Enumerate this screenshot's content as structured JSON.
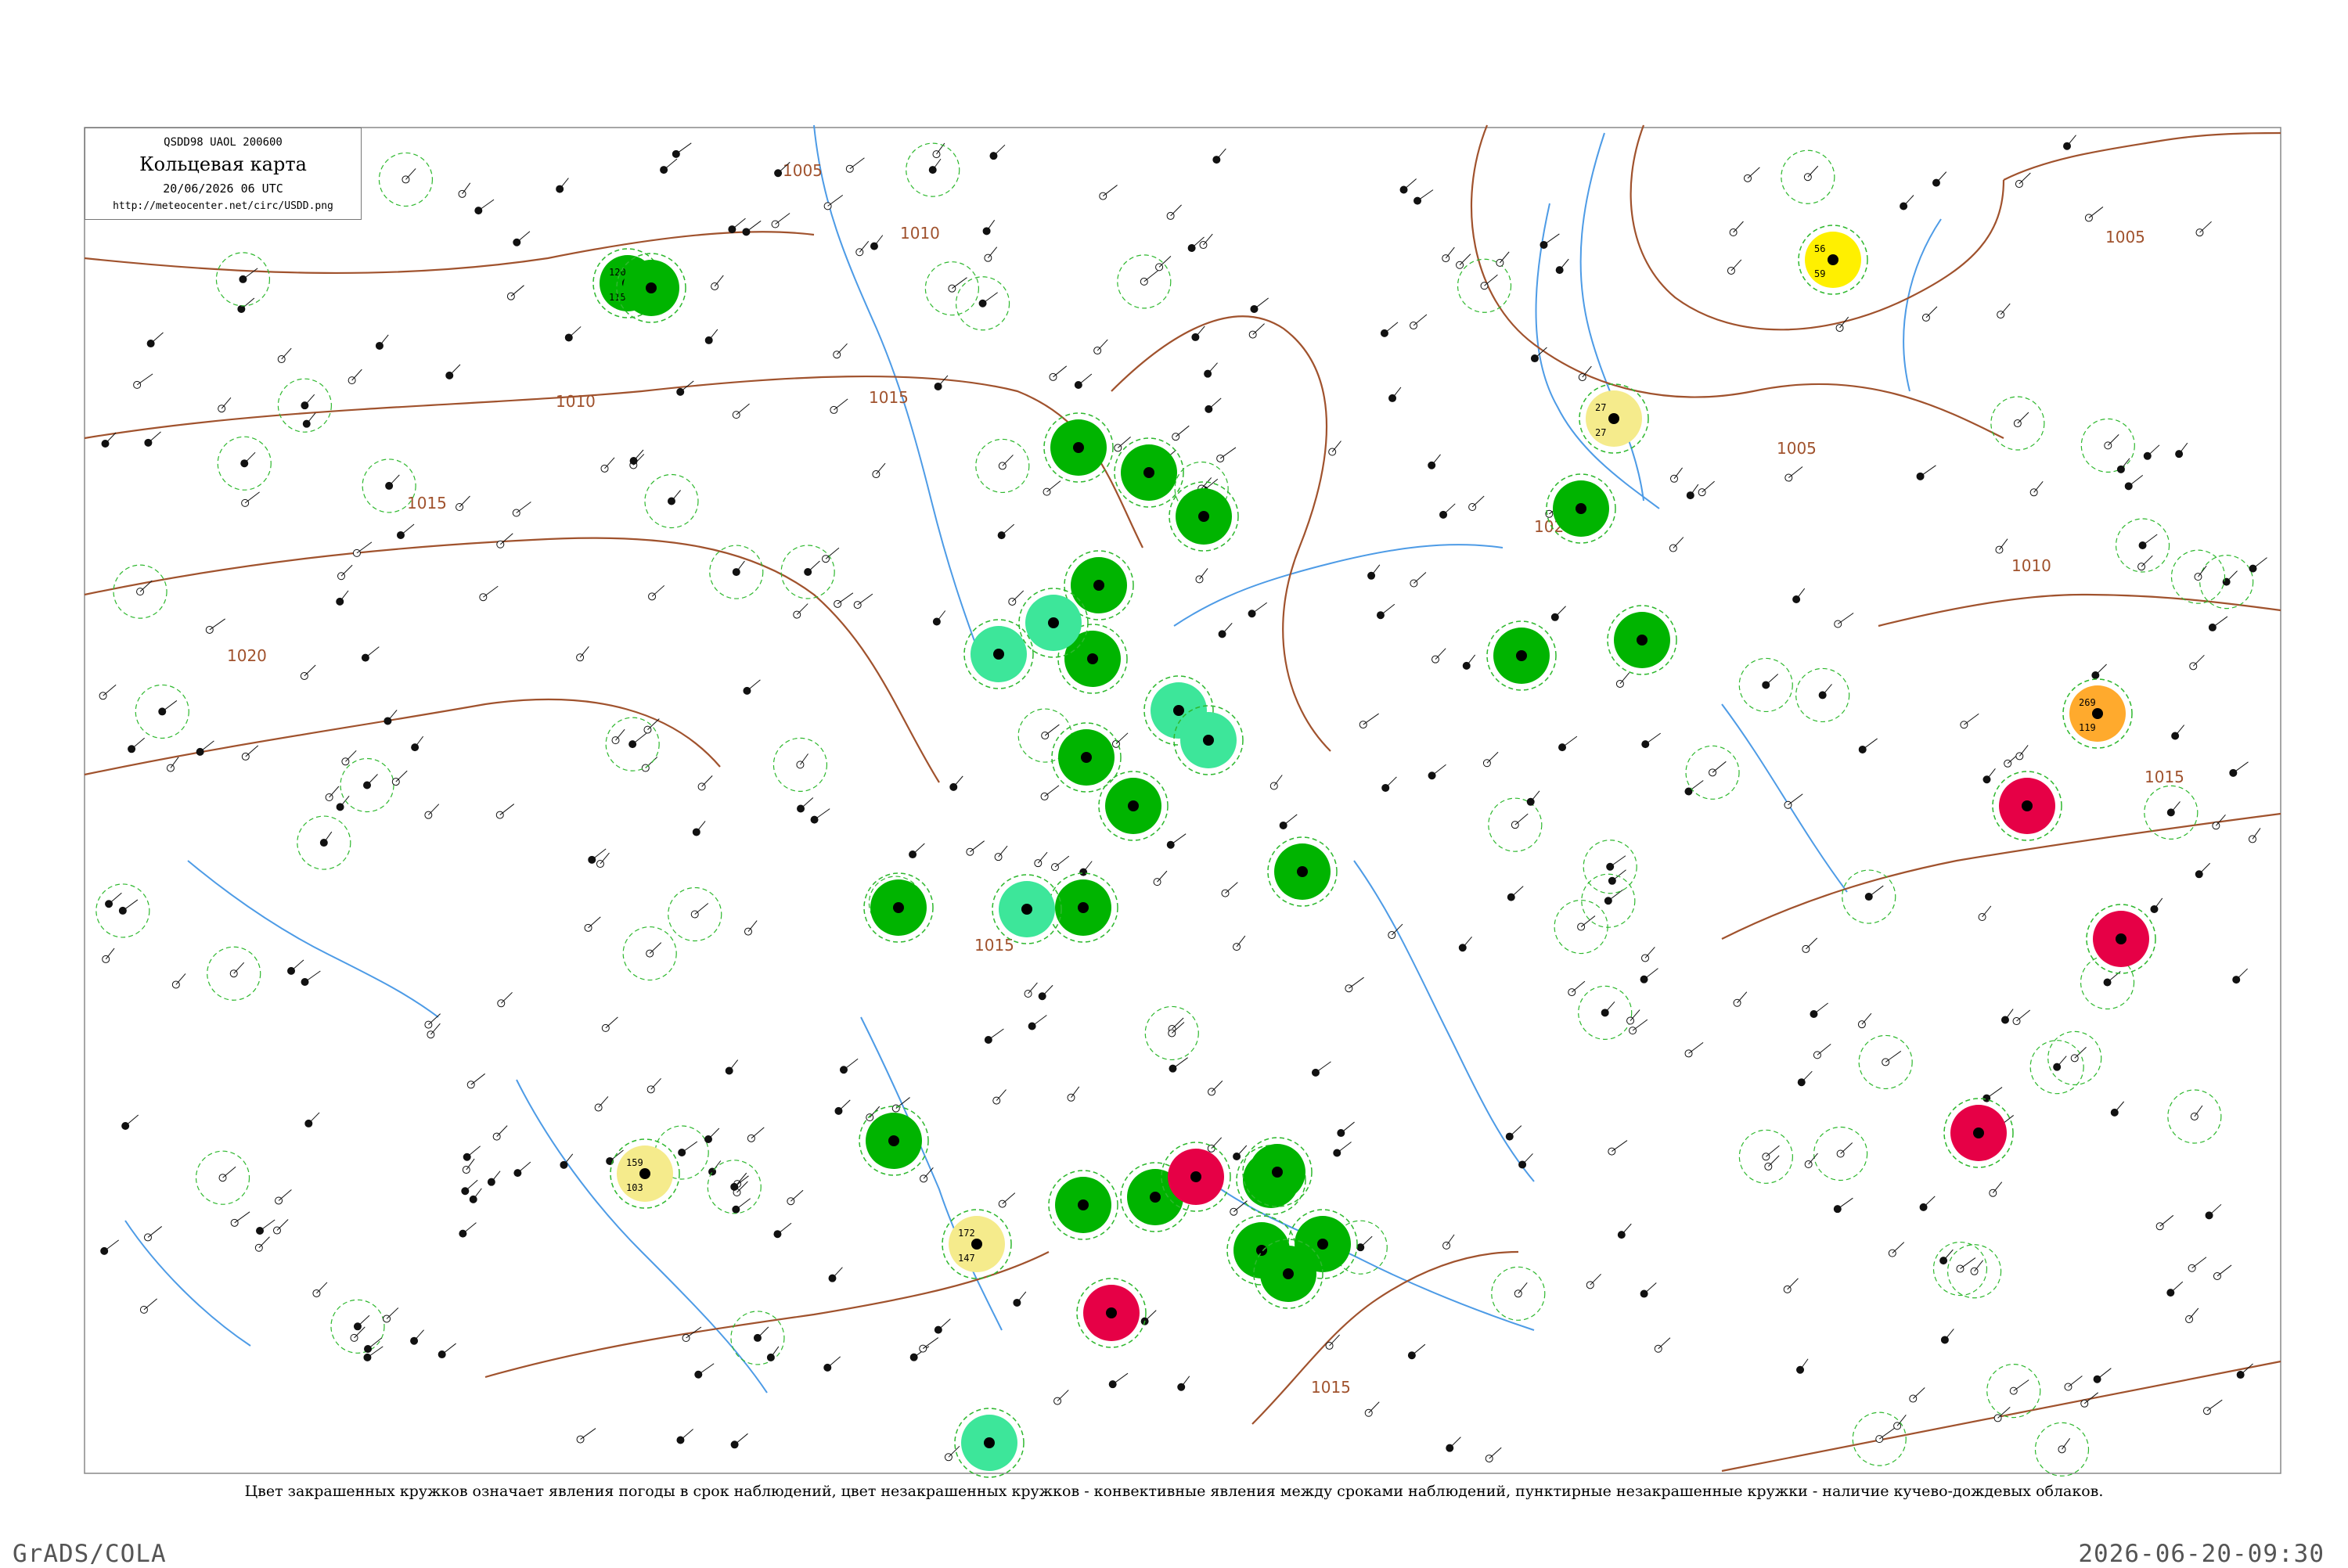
{
  "header": {
    "code": "QSDD98  UAOL  200600",
    "title": "Кольцевая карта",
    "date": "20/06/2026 06 UTC",
    "url": "http://meteocenter.net/circ/USDD.png"
  },
  "caption": "Цвет закрашенных кружков означает явления погоды в срок наблюдений, цвет незакрашенных кружков - конвективные явления между сроками наблюдений, пунктирные незакрашенные кружки - наличие кучево-дождевых облаков.",
  "footer": {
    "left": "GrADS/COLA",
    "right": "2026-06-20-09:30"
  },
  "isobars": [
    {
      "label": "1005"
    },
    {
      "label": "1010"
    },
    {
      "label": "1015"
    },
    {
      "label": "1020"
    },
    {
      "label": "1005"
    },
    {
      "label": "1010"
    },
    {
      "label": "1015"
    },
    {
      "label": "1020"
    },
    {
      "label": "1015"
    },
    {
      "label": "1010"
    },
    {
      "label": "1005"
    },
    {
      "label": "1015"
    },
    {
      "label": "1015"
    }
  ],
  "colors": {
    "green_filled": "#00b400",
    "light_green": "#3de69a",
    "red": "#e60046",
    "yellow": "#fff000",
    "pale_yellow": "#f5eb8c",
    "orange": "#ffaa2d",
    "isobar": "#a0522d",
    "river": "#4d9be6",
    "convective": "#2eb82e"
  },
  "stations": [
    {
      "kind": "green",
      "p": "120",
      "t": "115"
    },
    {
      "kind": "green",
      "p": "",
      "t": ""
    },
    {
      "kind": "green",
      "p": "",
      "t": ""
    },
    {
      "kind": "green",
      "p": "",
      "t": ""
    },
    {
      "kind": "green",
      "p": "",
      "t": ""
    },
    {
      "kind": "green",
      "p": "",
      "t": ""
    },
    {
      "kind": "green",
      "p": "",
      "t": ""
    },
    {
      "kind": "green",
      "p": "",
      "t": ""
    },
    {
      "kind": "green",
      "p": "",
      "t": ""
    },
    {
      "kind": "green",
      "p": "",
      "t": ""
    },
    {
      "kind": "green",
      "p": "",
      "t": ""
    },
    {
      "kind": "green",
      "p": "",
      "t": ""
    },
    {
      "kind": "green",
      "p": "",
      "t": ""
    },
    {
      "kind": "green",
      "p": "",
      "t": ""
    },
    {
      "kind": "green",
      "p": "",
      "t": ""
    },
    {
      "kind": "green",
      "p": "",
      "t": ""
    },
    {
      "kind": "green",
      "p": "",
      "t": ""
    },
    {
      "kind": "green",
      "p": "",
      "t": ""
    },
    {
      "kind": "green",
      "p": "",
      "t": ""
    },
    {
      "kind": "green",
      "p": "",
      "t": ""
    },
    {
      "kind": "green",
      "p": "",
      "t": ""
    },
    {
      "kind": "green",
      "p": "",
      "t": ""
    },
    {
      "kind": "green",
      "p": "",
      "t": ""
    },
    {
      "kind": "light",
      "p": "",
      "t": ""
    },
    {
      "kind": "light",
      "p": "",
      "t": ""
    },
    {
      "kind": "light",
      "p": "",
      "t": ""
    },
    {
      "kind": "light",
      "p": "",
      "t": ""
    },
    {
      "kind": "light",
      "p": "",
      "t": ""
    },
    {
      "kind": "light",
      "p": "",
      "t": ""
    },
    {
      "kind": "red",
      "p": "",
      "t": ""
    },
    {
      "kind": "red",
      "p": "",
      "t": ""
    },
    {
      "kind": "red",
      "p": "",
      "t": ""
    },
    {
      "kind": "red",
      "p": "",
      "t": ""
    },
    {
      "kind": "red",
      "p": "",
      "t": ""
    },
    {
      "kind": "yellow",
      "p": "56",
      "t": "59"
    },
    {
      "kind": "pale",
      "p": "27",
      "t": "27"
    },
    {
      "kind": "pale",
      "p": "159",
      "t": "103"
    },
    {
      "kind": "pale",
      "p": "172",
      "t": "147"
    },
    {
      "kind": "orange",
      "p": "269",
      "t": "119"
    }
  ]
}
